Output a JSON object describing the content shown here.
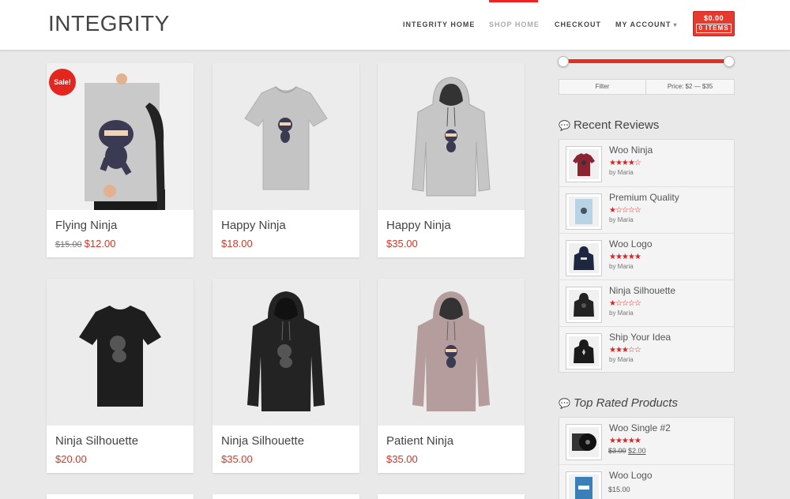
{
  "header": {
    "logo": "INTEGRITY",
    "nav": [
      {
        "label": "INTEGRITY HOME"
      },
      {
        "label": "SHOP HOME"
      },
      {
        "label": "CHECKOUT"
      },
      {
        "label": "MY ACCOUNT"
      }
    ],
    "cart": {
      "total": "$0.00",
      "items": "0 ITEMS"
    }
  },
  "products": [
    {
      "title": "Flying Ninja",
      "old_price": "$15.00",
      "price": "$12.00",
      "badge": "Sale!"
    },
    {
      "title": "Happy Ninja",
      "price": "$18.00"
    },
    {
      "title": "Happy Ninja",
      "price": "$35.00"
    },
    {
      "title": "Ninja Silhouette",
      "price": "$20.00"
    },
    {
      "title": "Ninja Silhouette",
      "price": "$35.00"
    },
    {
      "title": "Patient Ninja",
      "price": "$35.00"
    }
  ],
  "sidebar": {
    "price_filter": {
      "button": "Filter",
      "range": "Price: $2 — $35",
      "min_fraction": 0.0,
      "max_fraction": 1.0
    },
    "recent_reviews": {
      "title": "Recent Reviews",
      "items": [
        {
          "title": "Woo Ninja",
          "rating": 4,
          "by": "by Maria"
        },
        {
          "title": "Premium Quality",
          "rating": 1,
          "by": "by Maria"
        },
        {
          "title": "Woo Logo",
          "rating": 5,
          "by": "by Maria"
        },
        {
          "title": "Ninja Silhouette",
          "rating": 1,
          "by": "by Maria"
        },
        {
          "title": "Ship Your Idea",
          "rating": 3,
          "by": "by Maria"
        }
      ]
    },
    "top_rated": {
      "title": "Top Rated Products",
      "items": [
        {
          "title": "Woo Single #2",
          "rating": 4.5,
          "old_price": "$3.00",
          "price": "$2.00"
        },
        {
          "title": "Woo Logo",
          "price": "$15.00"
        }
      ]
    }
  },
  "colors": {
    "accent": "#e52d22",
    "price": "#d0382a"
  }
}
